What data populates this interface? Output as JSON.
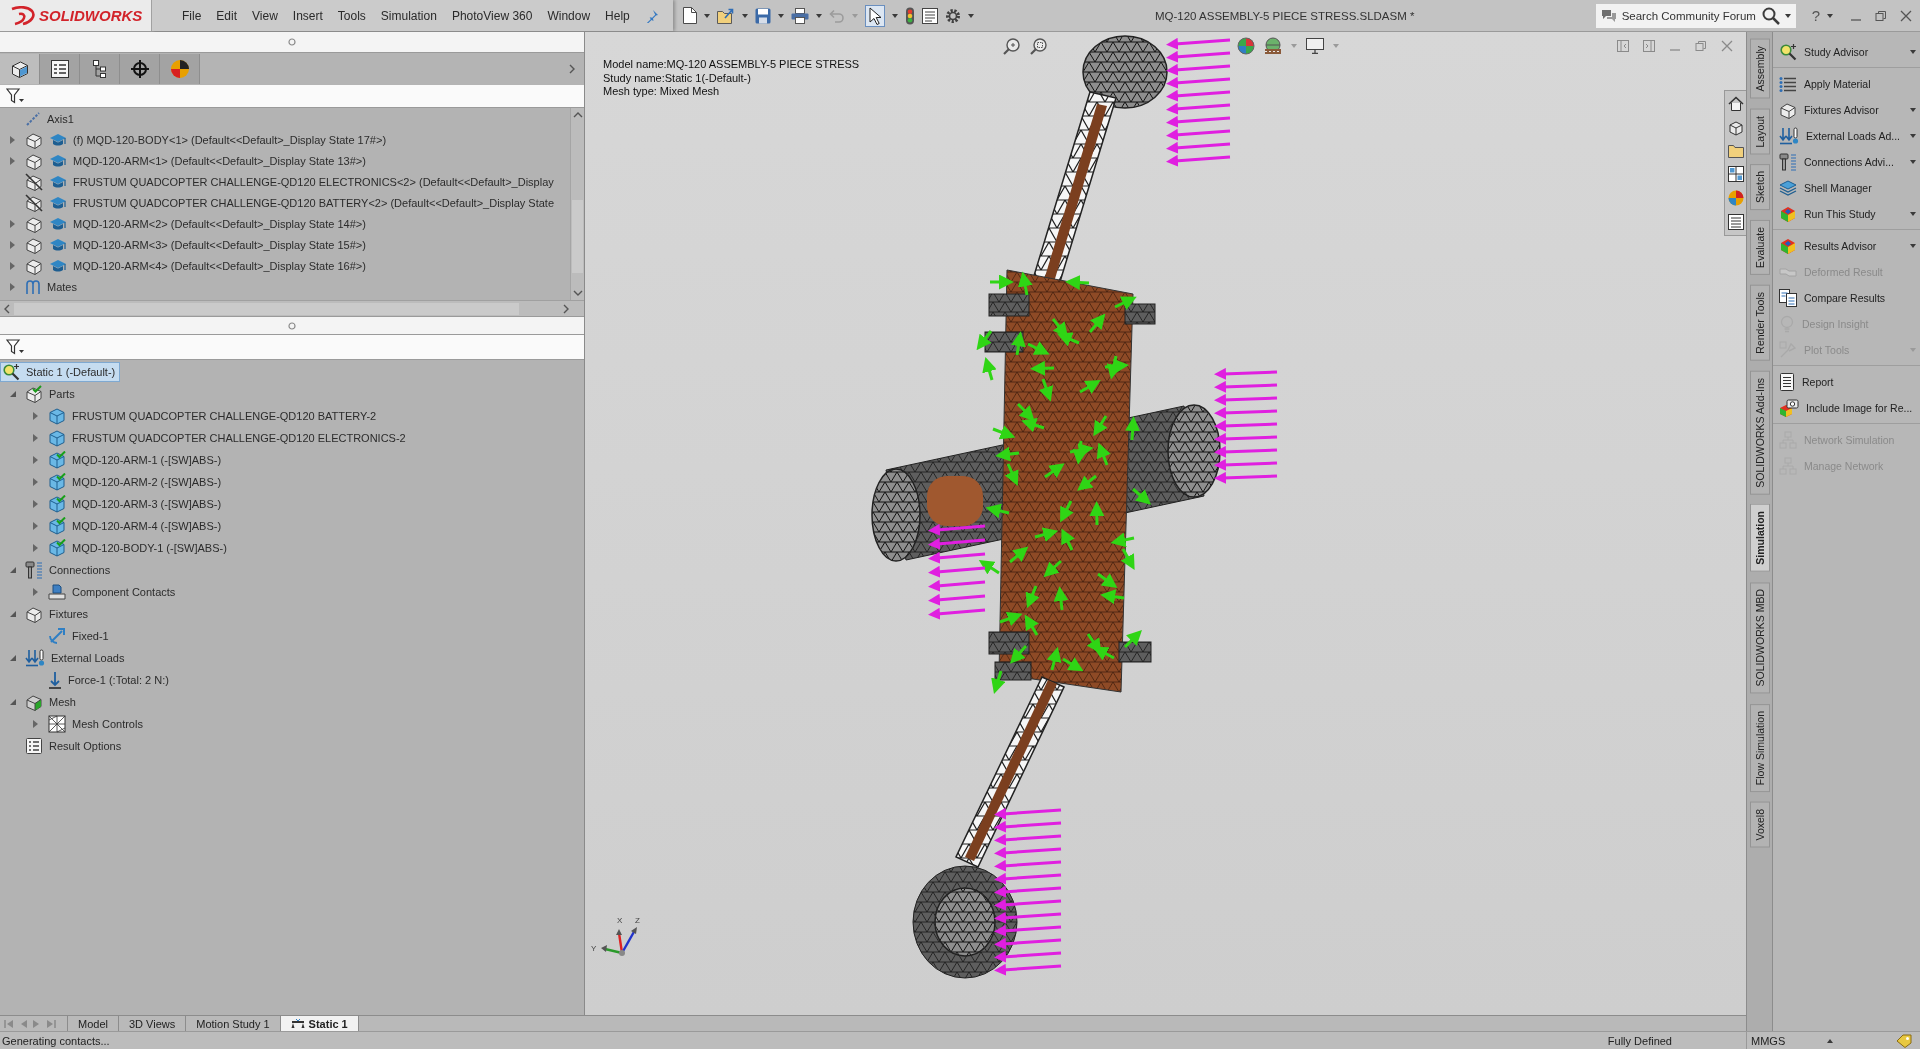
{
  "title_bar": {
    "logo": "SOLIDWORKS",
    "menu": [
      "File",
      "Edit",
      "View",
      "Insert",
      "Tools",
      "Simulation",
      "PhotoView 360",
      "Window",
      "Help"
    ],
    "document_title": "MQ-120 ASSEMBLY-5 PIECE STRESS.SLDASM *",
    "search": {
      "placeholder": "Search Community Forum"
    },
    "help": "?"
  },
  "manager_tabs": [
    {
      "selected": true
    },
    {
      "selected": false
    },
    {
      "selected": false
    },
    {
      "selected": false
    },
    {
      "selected": false
    }
  ],
  "feature_tree": [
    {
      "kind": "axis",
      "label": "Axis1",
      "selected": false
    },
    {
      "kind": "component",
      "label": "(f) MQD-120-BODY<1> (Default<<Default>_Display State 17#>)",
      "expanded": false,
      "excluded": false,
      "selected": false
    },
    {
      "kind": "component",
      "label": "MQD-120-ARM<1> (Default<<Default>_Display State 13#>)",
      "expanded": false,
      "excluded": false,
      "selected": false
    },
    {
      "kind": "component",
      "label": "FRUSTUM QUADCOPTER CHALLENGE-QD120 ELECTRONICS<2> (Default<<Default>_Display",
      "excluded": true,
      "selected": false
    },
    {
      "kind": "component",
      "label": "FRUSTUM QUADCOPTER CHALLENGE-QD120 BATTERY<2> (Default<<Default>_Display State",
      "excluded": true,
      "selected": false
    },
    {
      "kind": "component",
      "label": "MQD-120-ARM<2> (Default<<Default>_Display State 14#>)",
      "expanded": false,
      "excluded": false,
      "selected": false
    },
    {
      "kind": "component",
      "label": "MQD-120-ARM<3> (Default<<Default>_Display State 15#>)",
      "expanded": false,
      "excluded": false,
      "selected": false
    },
    {
      "kind": "component",
      "label": "MQD-120-ARM<4> (Default<<Default>_Display State 16#>)",
      "expanded": false,
      "excluded": false,
      "selected": false
    },
    {
      "kind": "mates",
      "label": "Mates",
      "expanded": false,
      "selected": false
    }
  ],
  "study_tree": [
    {
      "kind": "study",
      "label": "Static 1 (-Default-)",
      "selected": true,
      "children": [
        {
          "kind": "parts",
          "label": "Parts",
          "expanded": true,
          "selected": false,
          "children": [
            {
              "kind": "part",
              "label": "FRUSTUM QUADCOPTER CHALLENGE-QD120 BATTERY-2",
              "expanded": false,
              "material": false,
              "selected": false
            },
            {
              "kind": "part",
              "label": "FRUSTUM QUADCOPTER CHALLENGE-QD120 ELECTRONICS-2",
              "expanded": false,
              "material": false,
              "selected": false
            },
            {
              "kind": "part",
              "label": "MQD-120-ARM-1 (-[SW]ABS-)",
              "expanded": false,
              "material": true,
              "selected": false
            },
            {
              "kind": "part",
              "label": "MQD-120-ARM-2 (-[SW]ABS-)",
              "expanded": false,
              "material": true,
              "selected": false
            },
            {
              "kind": "part",
              "label": "MQD-120-ARM-3 (-[SW]ABS-)",
              "expanded": false,
              "material": true,
              "selected": false
            },
            {
              "kind": "part",
              "label": "MQD-120-ARM-4 (-[SW]ABS-)",
              "expanded": false,
              "material": true,
              "selected": false
            },
            {
              "kind": "part",
              "label": "MQD-120-BODY-1 (-[SW]ABS-)",
              "expanded": false,
              "material": true,
              "selected": false
            }
          ]
        },
        {
          "kind": "connections",
          "label": "Connections",
          "expanded": true,
          "selected": false,
          "children": [
            {
              "kind": "contacts",
              "label": "Component Contacts",
              "expanded": false,
              "selected": false
            }
          ]
        },
        {
          "kind": "fixtures",
          "label": "Fixtures",
          "expanded": true,
          "selected": false,
          "children": [
            {
              "kind": "fixture",
              "label": "Fixed-1",
              "selected": false
            }
          ]
        },
        {
          "kind": "loads",
          "label": "External Loads",
          "expanded": true,
          "selected": false,
          "children": [
            {
              "kind": "force",
              "label": "Force-1 (:Total: 2 N:)",
              "selected": false
            }
          ]
        },
        {
          "kind": "mesh",
          "label": "Mesh",
          "expanded": true,
          "selected": false,
          "children": [
            {
              "kind": "mesh_controls",
              "label": "Mesh Controls",
              "expanded": false,
              "selected": false
            }
          ]
        },
        {
          "kind": "result_options",
          "label": "Result Options",
          "selected": false
        }
      ]
    }
  ],
  "graphics": {
    "model_info": [
      "Model name:MQ-120 ASSEMBLY-5 PIECE STRESS",
      "Study name:Static 1(-Default-)",
      "Mesh type: Mixed Mesh"
    ],
    "triad_labels": [
      "Y",
      "X",
      "Z"
    ]
  },
  "command_tabs": [
    {
      "label": "Assembly",
      "selected": false
    },
    {
      "label": "Layout",
      "selected": false
    },
    {
      "label": "Sketch",
      "selected": false
    },
    {
      "label": "Evaluate",
      "selected": false
    },
    {
      "label": "Render Tools",
      "selected": false
    },
    {
      "label": "SOLIDWORKS Add-Ins",
      "selected": false
    },
    {
      "label": "Simulation",
      "selected": true
    },
    {
      "label": "SOLIDWORKS MBD",
      "selected": false
    },
    {
      "label": "Flow Simulation",
      "selected": false
    },
    {
      "label": "Voxel8",
      "selected": false
    }
  ],
  "command_groups": [
    {
      "items": [
        {
          "label": "Study Advisor",
          "dropdown": true,
          "disabled": false
        }
      ]
    },
    {
      "items": [
        {
          "label": "Apply Material",
          "dropdown": false,
          "disabled": false
        },
        {
          "label": "Fixtures Advisor",
          "dropdown": true,
          "disabled": false
        },
        {
          "label": "External Loads Ad...",
          "dropdown": true,
          "disabled": false
        },
        {
          "label": "Connections Advi...",
          "dropdown": true,
          "disabled": false
        },
        {
          "label": "Shell Manager",
          "dropdown": false,
          "disabled": false
        },
        {
          "label": "Run This Study",
          "dropdown": true,
          "disabled": false
        }
      ]
    },
    {
      "items": [
        {
          "label": "Results Advisor",
          "dropdown": true,
          "disabled": false
        },
        {
          "label": "Deformed Result",
          "dropdown": false,
          "disabled": true
        },
        {
          "label": "Compare Results",
          "dropdown": false,
          "disabled": false
        },
        {
          "label": "Design Insight",
          "dropdown": false,
          "disabled": true
        },
        {
          "label": "Plot Tools",
          "dropdown": true,
          "disabled": true
        }
      ]
    },
    {
      "items": [
        {
          "label": "Report",
          "dropdown": false,
          "disabled": false
        },
        {
          "label": "Include Image for Re...",
          "dropdown": false,
          "disabled": false
        }
      ]
    },
    {
      "items": [
        {
          "label": "Network Simulation",
          "dropdown": false,
          "disabled": true
        },
        {
          "label": "Manage Network",
          "dropdown": false,
          "disabled": true
        }
      ]
    }
  ],
  "document_tabs": [
    {
      "label": "Model",
      "kind": "plain",
      "selected": false
    },
    {
      "label": "3D Views",
      "kind": "plain",
      "selected": false
    },
    {
      "label": "Motion Study 1",
      "kind": "plain",
      "selected": false
    },
    {
      "label": "Static 1",
      "kind": "study",
      "selected": true
    }
  ],
  "status_bar": {
    "message": "Generating contacts...",
    "state": "Fully Defined",
    "units": "MMGS"
  }
}
